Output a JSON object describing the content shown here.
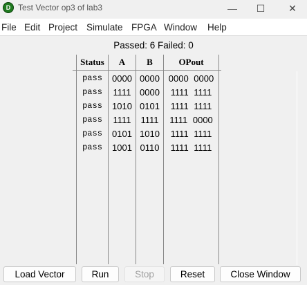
{
  "window": {
    "title": "Test Vector op3 of lab3",
    "icon": "app-logo-icon",
    "minimize": "—",
    "maximize": "☐",
    "close": "✕"
  },
  "menu": [
    "File",
    "Edit",
    "Project",
    "Simulate",
    "FPGA",
    "Window",
    "Help"
  ],
  "summary": "Passed: 6 Failed: 0",
  "table": {
    "headers": [
      "Status",
      "A",
      "B",
      "OPout"
    ],
    "rows": [
      [
        "pass",
        "0000",
        "0000",
        "0000 0000"
      ],
      [
        "pass",
        "1111",
        "0000",
        "1111 1111"
      ],
      [
        "pass",
        "1010",
        "0101",
        "1111 1111"
      ],
      [
        "pass",
        "1111",
        "1111",
        "1111 0000"
      ],
      [
        "pass",
        "0101",
        "1010",
        "1111 1111"
      ],
      [
        "pass",
        "1001",
        "0110",
        "1111 1111"
      ]
    ]
  },
  "buttons": {
    "load": "Load Vector",
    "run": "Run",
    "stop": "Stop",
    "reset": "Reset",
    "close": "Close Window"
  }
}
